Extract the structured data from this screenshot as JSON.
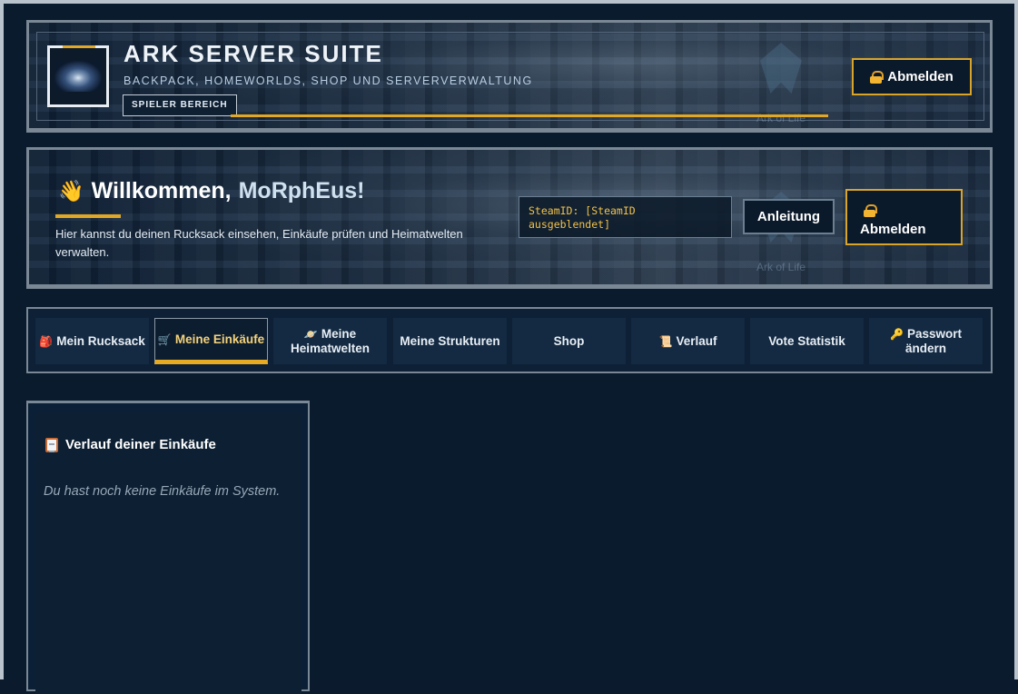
{
  "header": {
    "title": "ARK SERVER SUITE",
    "subtitle": "BACKPACK, HOMEWORLDS, SHOP UND SERVERVERWALTUNG",
    "role_badge": "SPIELER BEREICH",
    "watermark": "Ark of Life",
    "logout_label": "Abmelden",
    "icons": {
      "logo": "space-station-logo",
      "logout": "lock-icon"
    }
  },
  "welcome": {
    "greeting": "Willkommen,",
    "username": "MoRphEus!",
    "description": "Hier kannst du deinen Rucksack einsehen, Einkäufe prüfen und Heimatwelten verwalten.",
    "steamid": "SteamID: [SteamID ausgeblendet]",
    "guide_label": "Anleitung",
    "logout_label": "Abmelden",
    "watermark": "Ark of Life",
    "icons": {
      "greeting": "waving-hand-icon"
    }
  },
  "tabs": [
    {
      "label": "Mein Rucksack",
      "icon": "🎒",
      "icon_name": "backpack-icon",
      "active": false
    },
    {
      "label": "Meine Einkäufe",
      "icon": "🛒",
      "icon_name": "cart-icon",
      "active": true
    },
    {
      "label": "Meine Heimatwelten",
      "icon": "🪐",
      "icon_name": "planet-icon",
      "active": false
    },
    {
      "label": "Meine Strukturen",
      "icon": "",
      "icon_name": "",
      "active": false
    },
    {
      "label": "Shop",
      "icon": "",
      "icon_name": "",
      "active": false
    },
    {
      "label": "Verlauf",
      "icon": "📜",
      "icon_name": "scroll-icon",
      "active": false
    },
    {
      "label": "Vote Statistik",
      "icon": "",
      "icon_name": "",
      "active": false
    },
    {
      "label": "Passwort ändern",
      "icon": "🔑",
      "icon_name": "key-icon",
      "active": false
    }
  ],
  "history_card": {
    "title": "Verlauf deiner Einkäufe",
    "empty_message": "Du hast noch keine Einkäufe im System.",
    "icon": "clipboard-icon"
  },
  "colors": {
    "accent_gold": "#e2a823",
    "background": "#0a1b2d",
    "steamid_text": "#f2c24a",
    "active_tab_text": "#f5d27a"
  }
}
